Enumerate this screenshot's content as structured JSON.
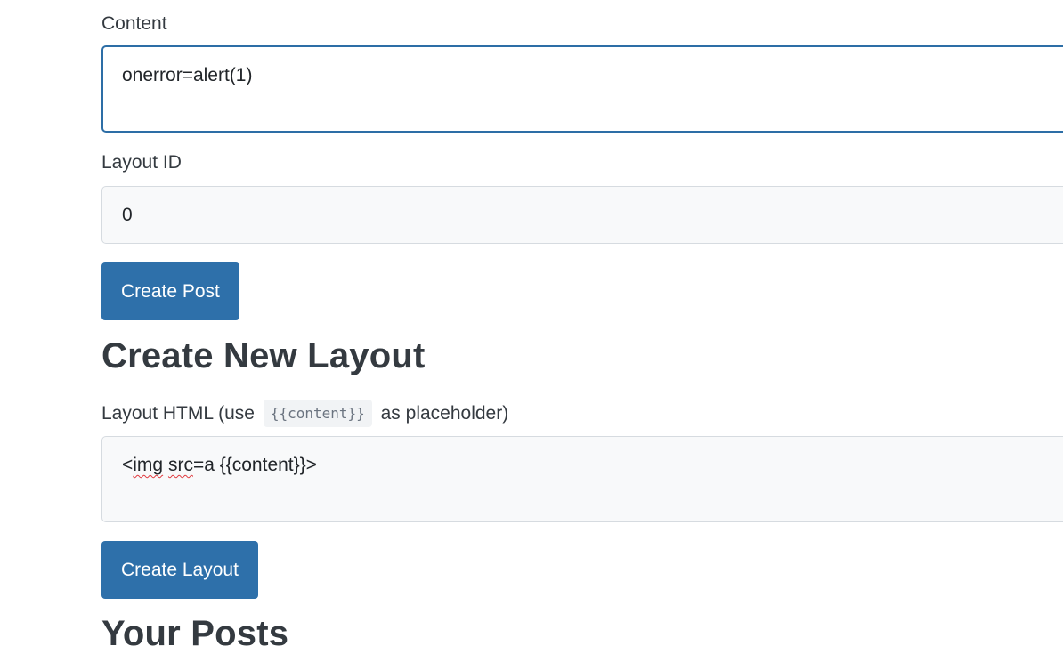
{
  "post_form": {
    "content_label": "Content",
    "content_value": "onerror=alert(1)",
    "layout_id_label": "Layout ID",
    "layout_id_value": "0",
    "submit_label": "Create Post"
  },
  "layout_form": {
    "heading": "Create New Layout",
    "html_label_prefix": "Layout HTML (use",
    "html_label_code": "{{content}}",
    "html_label_suffix": "as placeholder)",
    "html_value_part1": "<",
    "html_value_img": "img",
    "html_value_space": " ",
    "html_value_src": "src",
    "html_value_rest": "=a {{content}}>",
    "submit_label": "Create Layout"
  },
  "posts_section": {
    "heading": "Your Posts"
  },
  "colors": {
    "primary_button": "#2e70aa",
    "focus_border": "#2d6ea6",
    "spellcheck_underline": "#e0393e"
  }
}
